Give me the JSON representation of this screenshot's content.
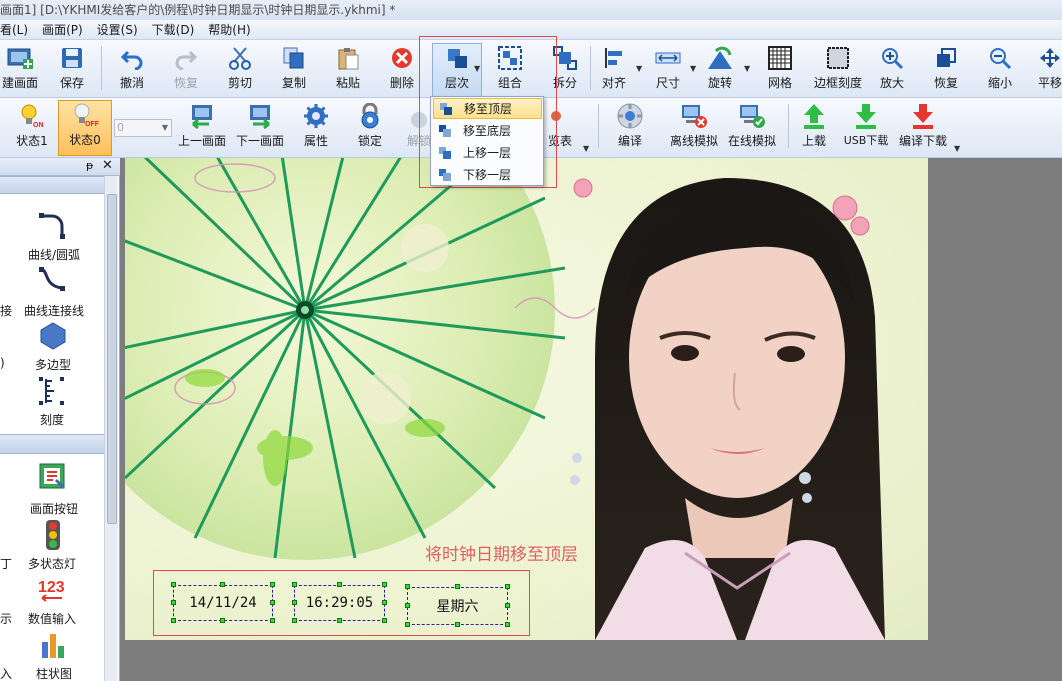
{
  "window": {
    "title": "画面1] [D:\\YKHMI发给客户的\\例程\\时钟日期显示\\时钟日期显示.ykhmi]  *"
  },
  "menu": [
    "看(L)",
    "画面(P)",
    "设置(S)",
    "下载(D)",
    "帮助(H)"
  ],
  "toolbar1": [
    {
      "label": "建画面",
      "icon": "new-screen-icon"
    },
    {
      "label": "保存",
      "icon": "save-icon"
    },
    {
      "label": "撤消",
      "icon": "undo-icon"
    },
    {
      "label": "恢复",
      "icon": "redo-icon",
      "disabled": true
    },
    {
      "label": "剪切",
      "icon": "cut-icon"
    },
    {
      "label": "复制",
      "icon": "copy-icon"
    },
    {
      "label": "粘贴",
      "icon": "paste-icon"
    },
    {
      "label": "删除",
      "icon": "delete-icon"
    },
    {
      "label": "层次",
      "icon": "layer-icon"
    },
    {
      "label": "组合",
      "icon": "group-icon"
    },
    {
      "label": "拆分",
      "icon": "ungroup-icon"
    },
    {
      "label": "对齐",
      "icon": "align-icon"
    },
    {
      "label": "尺寸",
      "icon": "size-icon"
    },
    {
      "label": "旋转",
      "icon": "rotate-icon"
    },
    {
      "label": "网格",
      "icon": "grid-icon"
    },
    {
      "label": "边框刻度",
      "icon": "border-scale-icon"
    },
    {
      "label": "放大",
      "icon": "zoom-in-icon"
    },
    {
      "label": "恢复",
      "icon": "restore-icon"
    },
    {
      "label": "缩小",
      "icon": "zoom-out-icon"
    },
    {
      "label": "平移",
      "icon": "pan-icon"
    }
  ],
  "toolbar2": [
    {
      "label": "状态1",
      "icon": "state-on-icon"
    },
    {
      "label": "状态0",
      "icon": "state-off-icon"
    },
    {
      "label": "上一画面",
      "icon": "prev-screen-icon"
    },
    {
      "label": "下一画面",
      "icon": "next-screen-icon"
    },
    {
      "label": "属性",
      "icon": "property-icon"
    },
    {
      "label": "锁定",
      "icon": "lock-icon"
    },
    {
      "label": "解锁",
      "icon": "unlock-icon",
      "disabled": true
    },
    {
      "label": "览表",
      "icon": "list-icon"
    },
    {
      "label": "编译",
      "icon": "compile-icon"
    },
    {
      "label": "离线模拟",
      "icon": "offline-sim-icon"
    },
    {
      "label": "在线模拟",
      "icon": "online-sim-icon"
    },
    {
      "label": "上载",
      "icon": "upload-icon"
    },
    {
      "label": "USB下载",
      "icon": "usb-download-icon"
    },
    {
      "label": "编译下载",
      "icon": "compile-download-icon"
    }
  ],
  "state_select": {
    "value": "0"
  },
  "layer_menu": [
    "移至顶层",
    "移至底层",
    "上移一层",
    "下移一层"
  ],
  "left_panel": {
    "section1": [
      {
        "label": "曲线/圆弧",
        "icon": "arc-icon"
      },
      {
        "label": "曲线连接线",
        "icon": "curve-connector-icon"
      },
      {
        "label": "多边型",
        "icon": "polygon-icon"
      },
      {
        "label": "刻度",
        "icon": "scale-icon"
      }
    ],
    "section1_partial": [
      "接",
      ")"
    ],
    "section2": [
      {
        "label": "画面按钮",
        "icon": "screen-button-icon"
      },
      {
        "label": "多状态灯",
        "icon": "multi-state-light-icon"
      },
      {
        "label": "数值输入",
        "icon": "numeric-input-icon"
      },
      {
        "label": "柱状图",
        "icon": "bar-chart-icon"
      }
    ],
    "section2_partial": [
      "丁",
      "示",
      "入"
    ]
  },
  "canvas": {
    "date": "14/11/24",
    "time": "16:29:05",
    "weekday": "星期六",
    "caption": "将时钟日期移至顶层"
  },
  "colors": {
    "highlight_red": "#e34a4a",
    "menu_highlight": "#ffe08a",
    "canvas_bg": "#eef3d2"
  }
}
